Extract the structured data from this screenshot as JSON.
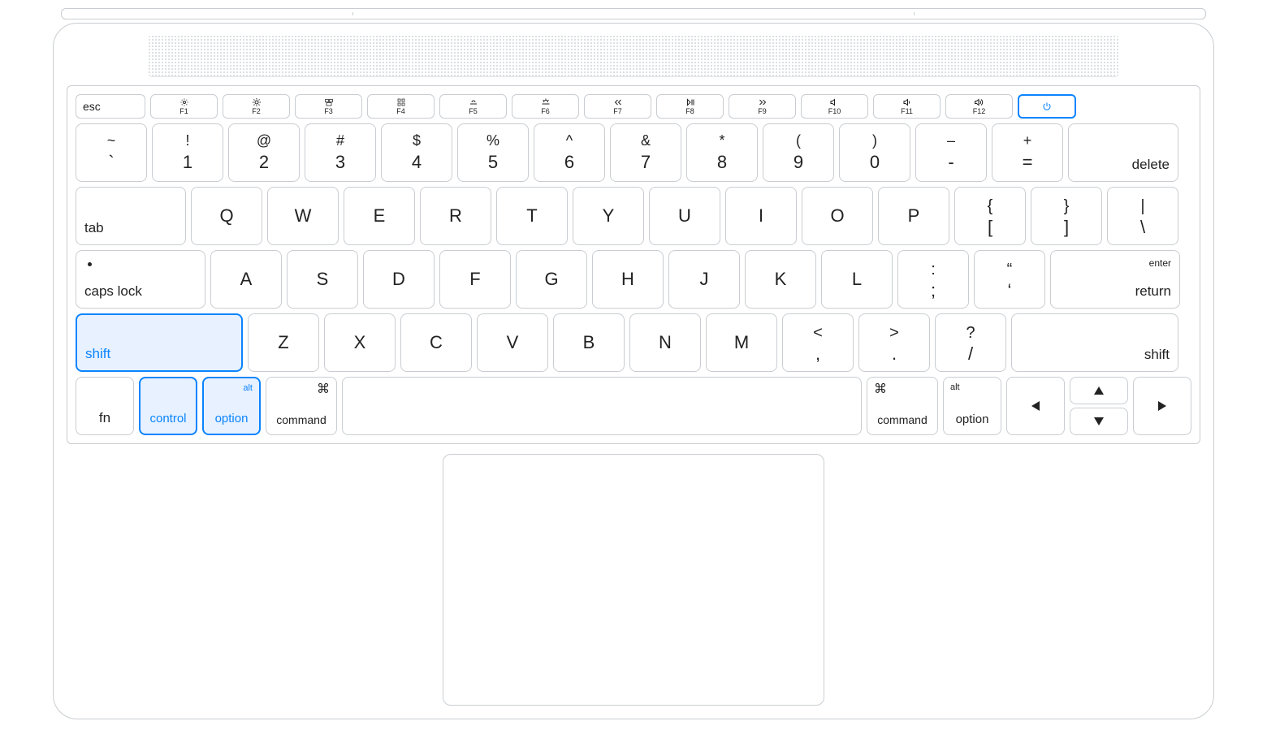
{
  "highlight_color": "#0a84ff",
  "fn_row": {
    "esc": "esc",
    "f1": "F1",
    "f2": "F2",
    "f3": "F3",
    "f4": "F4",
    "f5": "F5",
    "f6": "F6",
    "f7": "F7",
    "f8": "F8",
    "f9": "F9",
    "f10": "F10",
    "f11": "F11",
    "f12": "F12"
  },
  "num_row": {
    "tilde_upper": "~",
    "tilde_lower": "`",
    "k1u": "!",
    "k1l": "1",
    "k2u": "@",
    "k2l": "2",
    "k3u": "#",
    "k3l": "3",
    "k4u": "$",
    "k4l": "4",
    "k5u": "%",
    "k5l": "5",
    "k6u": "^",
    "k6l": "6",
    "k7u": "&",
    "k7l": "7",
    "k8u": "*",
    "k8l": "8",
    "k9u": "(",
    "k9l": "9",
    "k0u": ")",
    "k0l": "0",
    "minus_u": "–",
    "minus_l": "-",
    "eq_u": "+",
    "eq_l": "=",
    "delete": "delete"
  },
  "tab_row": {
    "tab": "tab",
    "q": "Q",
    "w": "W",
    "e": "E",
    "r": "R",
    "t": "T",
    "y": "Y",
    "u": "U",
    "i": "I",
    "o": "O",
    "p": "P",
    "lb_u": "{",
    "lb_l": "[",
    "rb_u": "}",
    "rb_l": "]",
    "bs_u": "|",
    "bs_l": "\\"
  },
  "caps_row": {
    "caps": "caps lock",
    "a": "A",
    "s": "S",
    "d": "D",
    "f": "F",
    "g": "G",
    "h": "H",
    "j": "J",
    "k": "K",
    "l": "L",
    "semi_u": ":",
    "semi_l": ";",
    "quote_u": "“",
    "quote_l": "‘",
    "enter": "enter",
    "return": "return"
  },
  "shift_row": {
    "shift_l": "shift",
    "shift_r": "shift",
    "z": "Z",
    "x": "X",
    "c": "C",
    "v": "V",
    "b": "B",
    "n": "N",
    "m": "M",
    "comma_u": "<",
    "comma_l": ",",
    "period_u": ">",
    "period_l": ".",
    "slash_u": "?",
    "slash_l": "/"
  },
  "bottom_row": {
    "fn": "fn",
    "control": "control",
    "option": "option",
    "alt": "alt",
    "command": "command",
    "cmd_symbol": "⌘"
  },
  "highlighted_keys": [
    "shift-left",
    "control-left",
    "option-left",
    "power"
  ]
}
